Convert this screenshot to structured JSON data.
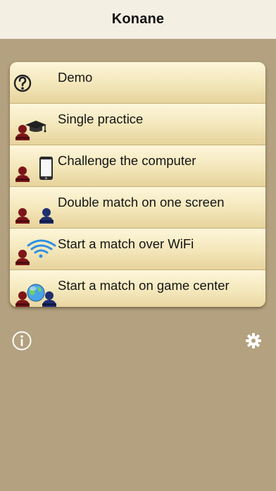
{
  "app": {
    "title": "Konane"
  },
  "menu": {
    "items": [
      {
        "label": "Demo",
        "icon": "help-icon"
      },
      {
        "label": "Single practice",
        "icon": "student-icon"
      },
      {
        "label": "Challenge the computer",
        "icon": "player-vs-phone-icon"
      },
      {
        "label": "Double match on one screen",
        "icon": "two-players-icon"
      },
      {
        "label": "Start a match over WiFi",
        "icon": "wifi-player-icon"
      },
      {
        "label": "Start a match on game center",
        "icon": "game-center-icon"
      }
    ]
  },
  "footer": {
    "info_icon": "info-icon",
    "settings_icon": "gear-icon"
  },
  "colors": {
    "background": "#b3a17f",
    "navbar": "#f4efe3",
    "menu_top": "#fdf6da",
    "menu_bottom": "#e7d39c",
    "player_red": "#7d1518",
    "player_blue": "#1f2f6e",
    "wifi_blue": "#2f8fe0"
  }
}
